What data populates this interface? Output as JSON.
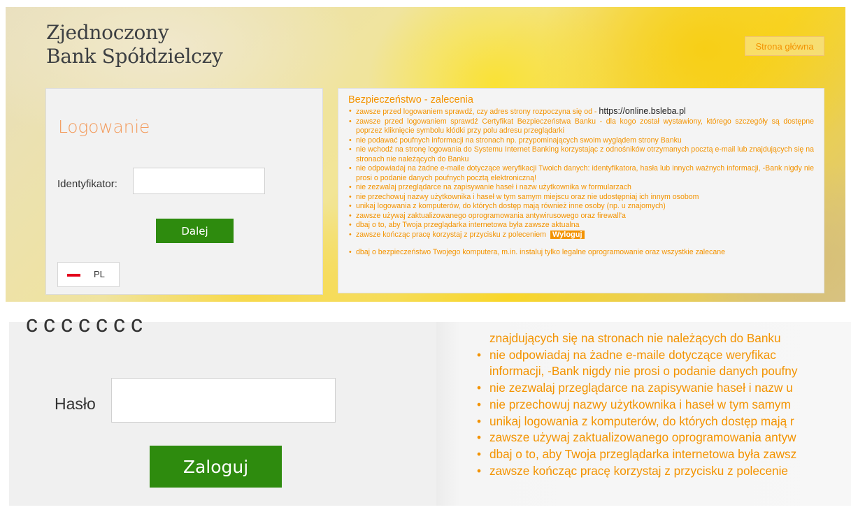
{
  "top": {
    "bank_name": [
      "Zjednoczony",
      "Bank Spółdzielczy"
    ],
    "home_link": "Strona główna",
    "login": {
      "title": "Logowanie",
      "id_label": "Identyfikator:",
      "id_value": "",
      "next_button": "Dalej",
      "language": "PL"
    },
    "security": {
      "title": "Bezpieczeństwo - zalecenia",
      "url": "https://online.bsleba.pl",
      "items": [
        "zawsze przed logowaniem sprawdź, czy adres strony rozpoczyna się od -",
        "zawsze przed logowaniem sprawdź Certyfikat Bezpieczeństwa Banku - dla kogo został wystawiony, którego szczegóły są dostępne poprzez kliknięcie symbolu kłódki przy polu adresu przeglądarki",
        "nie podawać poufnych informacji na stronach np. przypominających swoim wyglądem strony Banku",
        "nie wchodź na stronę logowania do Systemu Internet Banking korzystając z odnośników otrzymanych pocztą e-mail lub znajdujących się na stronach nie należących do Banku",
        "nie odpowiadaj na żadne e-maile dotyczące weryfikacji Twoich danych: identyfikatora, hasła lub innych ważnych informacji, -Bank nigdy nie prosi o podanie danych poufnych pocztą elektroniczną!",
        "nie zezwalaj przeglądarce na zapisywanie haseł i nazw użytkownika w formularzach",
        "nie przechowuj nazwy użytkownika i haseł w tym samym miejscu oraz nie udostępniaj ich innym osobom",
        "unikaj logowania z komputerów, do których dostęp mają również inne osoby (np. u znajomych)",
        "zawsze używaj zaktualizowanego oprogramowania antywirusowego oraz firewall'a",
        "dbaj o to, aby Twoja przeglądarka internetowa była zawsze aktualna",
        "zawsze kończąc pracę korzystaj z przycisku z poleceniem",
        "dbaj o bezpieczeństwo Twojego komputera, m.in. instaluj tylko legalne oprogramowanie oraz wszystkie zalecane"
      ],
      "logout_label": "Wyloguj"
    }
  },
  "bottom": {
    "cut_text": "ccccccc",
    "password_label": "Hasło",
    "password_value": "",
    "login_button": "Zaloguj",
    "lines": [
      "znajdujących się na stronach nie należących do Banku",
      "nie odpowiadaj na żadne e-maile dotyczące weryfikac",
      "informacji, -Bank nigdy nie prosi o podanie danych poufny",
      "nie zezwalaj przeglądarce na zapisywanie haseł i nazw u",
      "nie przechowuj nazwy użytkownika i haseł w tym samym",
      "unikaj logowania z komputerów, do których dostęp mają r",
      "zawsze używaj zaktualizowanego oprogramowania antyw",
      "dbaj o to, aby Twoja przeglądarka internetowa była zawsz",
      "zawsze kończąc pracę korzystaj z przycisku z polecenie"
    ]
  },
  "colors": {
    "accent_orange": "#f39300",
    "login_title": "#f39c5e",
    "button_green": "#2e8b0e",
    "flag_red": "#e3001b"
  }
}
